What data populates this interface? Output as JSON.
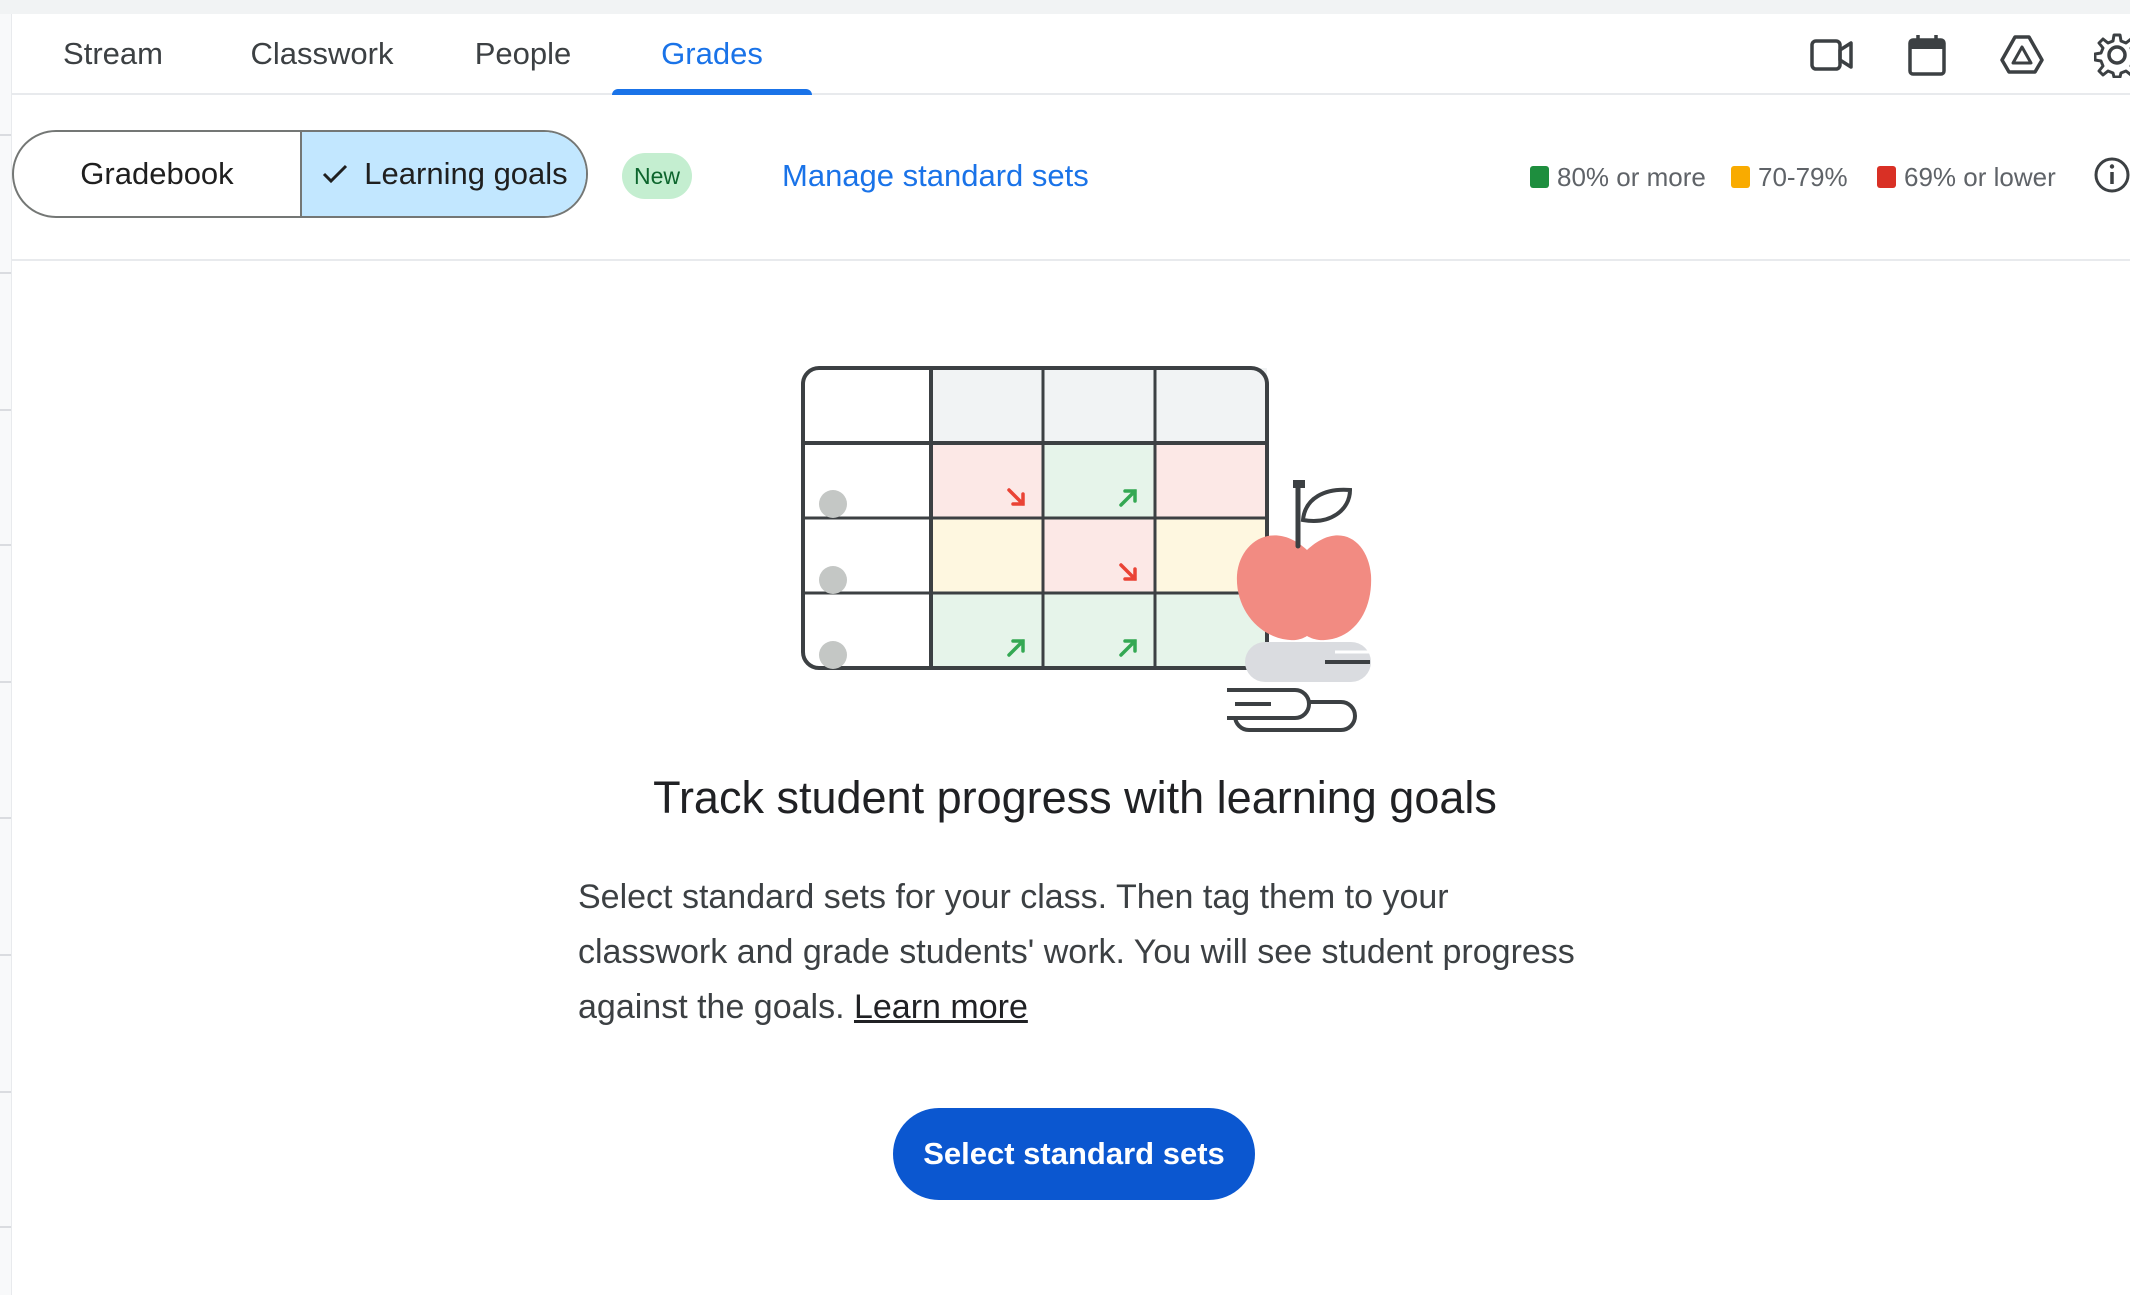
{
  "tabs": [
    {
      "label": "Stream",
      "active": false
    },
    {
      "label": "Classwork",
      "active": false
    },
    {
      "label": "People",
      "active": false
    },
    {
      "label": "Grades",
      "active": true
    }
  ],
  "header_icons": [
    "video-camera-icon",
    "calendar-icon",
    "drive-icon",
    "settings-icon"
  ],
  "toolbar": {
    "view_toggle": {
      "options": [
        {
          "label": "Gradebook",
          "selected": false
        },
        {
          "label": "Learning goals",
          "selected": true
        }
      ]
    },
    "new_badge": "New",
    "manage_link": "Manage standard sets",
    "legend": [
      {
        "label": "80% or more",
        "color": "#1e8e3e"
      },
      {
        "label": "70-79%",
        "color": "#f9ab00"
      },
      {
        "label": "69% or lower",
        "color": "#d93025"
      }
    ],
    "info_icon": "info-icon"
  },
  "main": {
    "illustration": "gradebook-illustration-with-apple-and-books",
    "heading": "Track student progress with learning goals",
    "description": "Select standard sets for your class. Then tag them to your classwork and grade students' work. You will see student progress against the goals.",
    "learn_more": "Learn more",
    "cta_label": "Select standard sets"
  },
  "colors": {
    "accent": "#1a73e8",
    "cta": "#0b57d0",
    "selected_segment": "#c2e7ff"
  }
}
